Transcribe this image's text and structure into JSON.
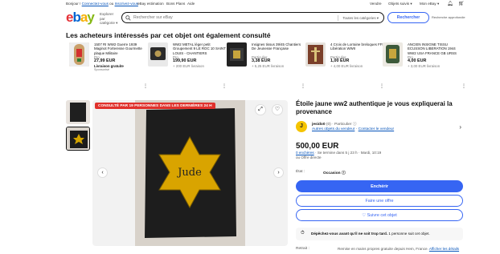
{
  "topbar": {
    "greeting": "Bonjour !",
    "login": "Connectez-vous",
    "or": "ou",
    "register": "Inscrivez-vous",
    "estimation": "eBay estimation",
    "deals": "Bons Plans",
    "help": "Aide",
    "sell": "Vendre",
    "watched": "Objets suivis",
    "my_ebay": "Mon eBay"
  },
  "header": {
    "logo": [
      "e",
      "b",
      "a",
      "y"
    ],
    "category_label": "Explorer par catégorie",
    "search_placeholder": "Rechercher sur eBay",
    "category_select": "Toutes les catégories",
    "search_button": "Rechercher",
    "advanced": "Recherche approfondie"
  },
  "related": {
    "heading": "Les acheteurs intéressés par cet objet ont également consulté",
    "items": [
      {
        "title": "1507 RI WW2 Guerre 1939 Maginot Forteresse Gourmette plaque Militaire",
        "cond": "Pro",
        "price": "27,99 EUR",
        "shipping": "Livraison gratuite",
        "sponsored": "Sponsorisé"
      },
      {
        "title": "WW2 METAL léger petit Groupement 9 LE ROC 10 SAINT LOUIS - CHANTIERS",
        "cond": "Pro",
        "price": "199,90 EUR",
        "shipping": "+ 200 EUR livraison",
        "sponsored": ""
      },
      {
        "title": "Insignes tissus 39/45 Chantiers De Jeunesse Française",
        "cond": "Particulier",
        "price": "3,38 EUR",
        "shipping": "+ 5,25 EUR livraison",
        "sponsored": ""
      },
      {
        "title": "4 Croix de Lorraine breloques FFI Libération WWII",
        "cond": "Particulier",
        "price": "1,00 EUR",
        "shipping": "+ 4,00 EUR livraison",
        "sponsored": ""
      },
      {
        "title": "ANCIEN INSIGNE TISSU ECUSSON LIBERATION 1944 WW2 USA FRANCE GB URSS",
        "cond": "Pro",
        "price": "4,00 EUR",
        "shipping": "+ 3,00 EUR livraison",
        "sponsored": ""
      }
    ]
  },
  "gallery": {
    "promo": "CONSULTÉ PAR 19 PERSONNES DANS LES DERNIÈRES 24 H",
    "photo_text": "Jude"
  },
  "item": {
    "title": "Étoile jaune ww2 authentique je vous expliquerai la provenance",
    "seller_initial": "J",
    "seller_name": "jesido0",
    "seller_feedback": "(0)",
    "seller_type": "Particulier",
    "seller_other": "Autres objets du vendeur",
    "seller_contact": "Contacter le vendeur",
    "price": "500,00 EUR",
    "bids_count": "0 enchères",
    "bids_end": "· Se termine dans 5 j 23 h · Mardi, 10:19",
    "buy_now": "ou Offre directe",
    "state_label": "État :",
    "state_value": "Occasion",
    "bid_button": "Enchérir",
    "offer_button": "Faire une offre",
    "watch_button": "Suivre cet objet",
    "notice_bold": "Dépêchez-vous avant qu'il ne soit trop tard.",
    "notice_rest": "1 personne suit cet objet.",
    "shipping_label": "Retrait :",
    "shipping_value": "Remise en mains propres gratuite depuis Hem, France.",
    "shipping_link": "Afficher les détails"
  },
  "colors": {
    "accent": "#3665f3",
    "promo": "#e0312c",
    "star": "#e9b200"
  }
}
